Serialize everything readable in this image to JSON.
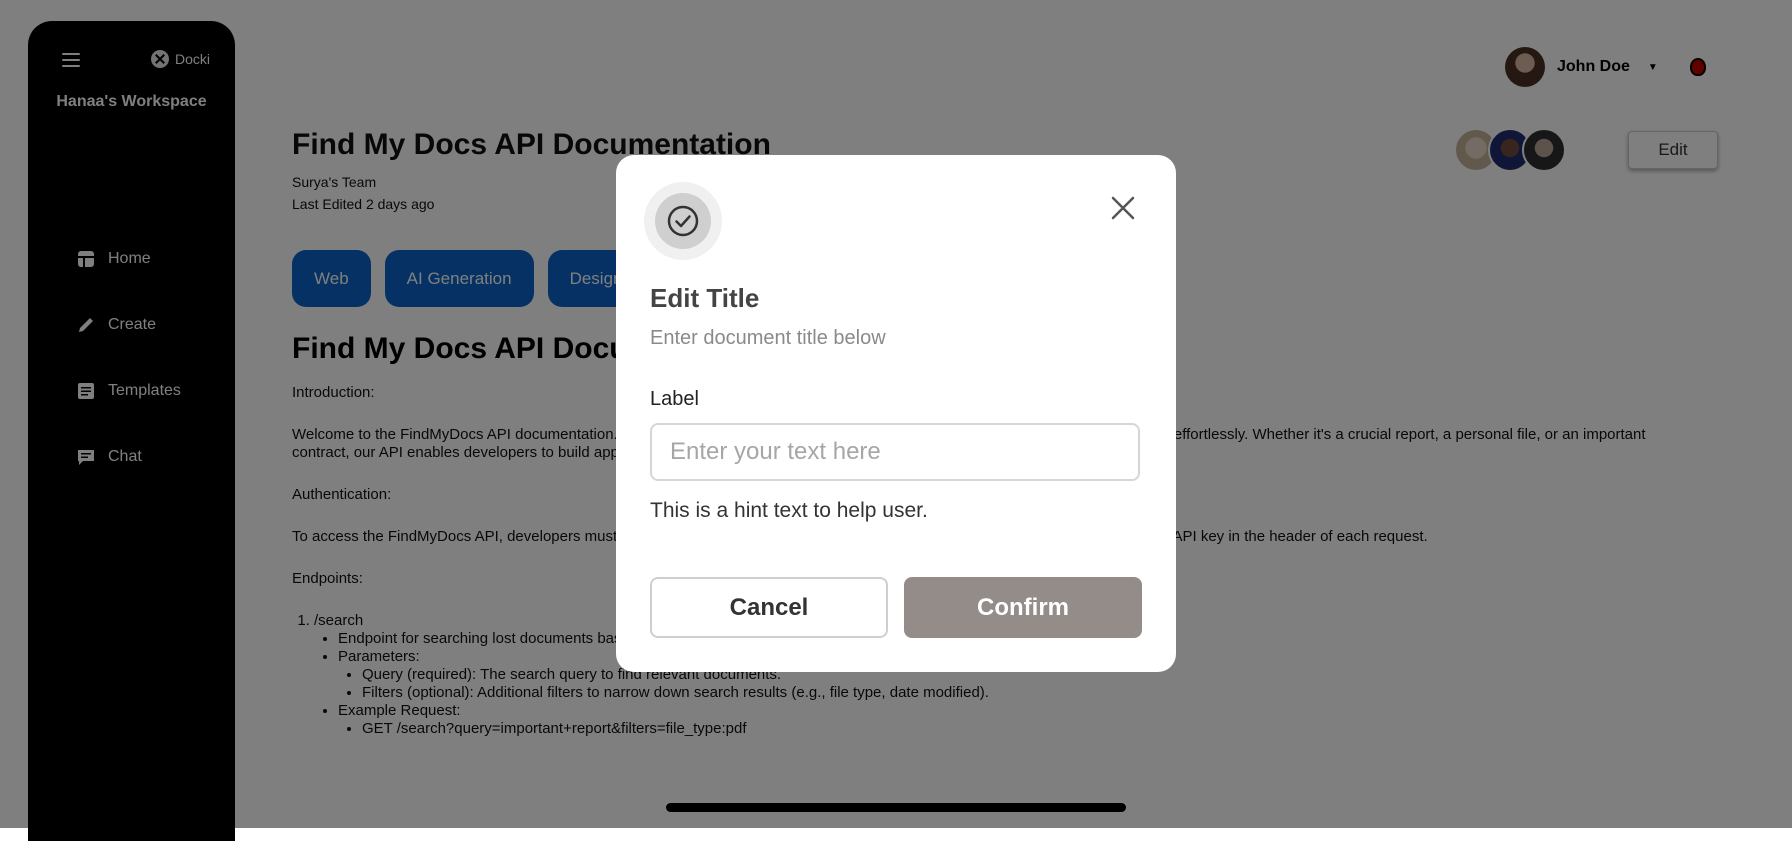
{
  "sidebar": {
    "brand": "Docki",
    "workspace": "Hanaa's Workspace",
    "items": [
      {
        "label": "Home",
        "icon": "home-icon"
      },
      {
        "label": "Create",
        "icon": "pencil-icon"
      },
      {
        "label": "Templates",
        "icon": "templates-icon"
      },
      {
        "label": "Chat",
        "icon": "chat-icon"
      }
    ]
  },
  "header": {
    "user_name": "John Doe"
  },
  "document": {
    "title": "Find My Docs API Documentation",
    "team": "Surya's Team",
    "last_edited": "Last Edited 2 days ago",
    "edit_label": "Edit",
    "tags": [
      "Web",
      "AI Generation",
      "Design"
    ],
    "heading": "Find My Docs API Documentation",
    "intro_label": "Introduction:",
    "intro_text": "Welcome to the FindMyDocs API documentation. Our API helps developers integrate a powerful document search to find documents effortlessly. Whether it's a crucial report, a personal file, or an important contract, our API enables developers to build applications that locate lost documents quickly and securely.",
    "auth_label": "Authentication:",
    "auth_text": "To access the FindMyDocs API, developers must obtain an API key by registering on our developer portal. Authentication is done via API key in the header of each request.",
    "endpoints_label": "Endpoints:",
    "endpoint_path": "/search",
    "endpoint_desc": "Endpoint for searching lost documents based on query parameters.",
    "params_label": "Parameters:",
    "param_query": "Query (required): The search query to find relevant documents.",
    "param_filters": "Filters (optional): Additional filters to narrow down search results (e.g., file type, date modified).",
    "example_label": "Example Request:",
    "example_request": "GET /search?query=important+report&filters=file_type:pdf"
  },
  "modal": {
    "icon": "check-circle-icon",
    "title": "Edit Title",
    "subtitle": "Enter document title below",
    "label": "Label",
    "input_placeholder": "Enter your text here",
    "input_value": "",
    "hint": "This is a hint text to help user.",
    "cancel_label": "Cancel",
    "confirm_label": "Confirm"
  },
  "colors": {
    "sidebar_bg": "#000000",
    "tag_bg": "#0a63c9",
    "confirm_bg": "#938c88",
    "overlay": "rgba(0,0,0,0.5)"
  }
}
